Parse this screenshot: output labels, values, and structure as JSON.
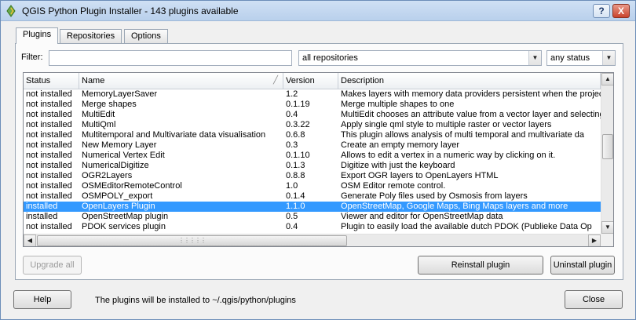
{
  "window": {
    "title": "QGIS Python Plugin Installer - 143 plugins available",
    "help_glyph": "?",
    "close_glyph": "X"
  },
  "tabs": [
    {
      "label": "Plugins",
      "active": true
    },
    {
      "label": "Repositories",
      "active": false
    },
    {
      "label": "Options",
      "active": false
    }
  ],
  "filter": {
    "label": "Filter:",
    "value": "",
    "placeholder": ""
  },
  "repository_select": {
    "selected": "all repositories"
  },
  "status_select": {
    "selected": "any status"
  },
  "table": {
    "columns": [
      "Status",
      "Name",
      "Version",
      "Description"
    ],
    "rows": [
      {
        "status": "not installed",
        "name": "MemoryLayerSaver",
        "version": "1.2",
        "description": "Makes layers with memory data providers persistent when the projec",
        "selected": false
      },
      {
        "status": "not installed",
        "name": "Merge shapes",
        "version": "0.1.19",
        "description": "Merge multiple shapes to one",
        "selected": false
      },
      {
        "status": "not installed",
        "name": "MultiEdit",
        "version": "0.4",
        "description": "MultiEdit chooses an attribute value from a vector layer and selecting",
        "selected": false
      },
      {
        "status": "not installed",
        "name": "MultiQml",
        "version": "0.3.22",
        "description": "Apply single qml style to multiple raster or vector layers",
        "selected": false
      },
      {
        "status": "not installed",
        "name": "Multitemporal and Multivariate data visualisation",
        "version": "0.6.8",
        "description": "This plugin allows analysis of multi temporal and multivariate da",
        "selected": false
      },
      {
        "status": "not installed",
        "name": "New Memory Layer",
        "version": "0.3",
        "description": "Create an empty memory layer",
        "selected": false
      },
      {
        "status": "not installed",
        "name": "Numerical Vertex Edit",
        "version": "0.1.10",
        "description": "Allows to edit a vertex in a numeric way by clicking on it.",
        "selected": false
      },
      {
        "status": "not installed",
        "name": "NumericalDigitize",
        "version": "0.1.3",
        "description": "Digitize with just the keyboard",
        "selected": false
      },
      {
        "status": "not installed",
        "name": "OGR2Layers",
        "version": "0.8.8",
        "description": "Export OGR layers to OpenLayers HTML",
        "selected": false
      },
      {
        "status": "not installed",
        "name": "OSMEditorRemoteControl",
        "version": "1.0",
        "description": "OSM Editor remote control.",
        "selected": false
      },
      {
        "status": "not installed",
        "name": "OSMPOLY_export",
        "version": "0.1.4",
        "description": "Generate Poly files used by Osmosis from layers",
        "selected": false
      },
      {
        "status": "installed",
        "name": "OpenLayers Plugin",
        "version": "1.1.0",
        "description": "OpenStreetMap, Google Maps, Bing Maps layers and more",
        "selected": true
      },
      {
        "status": "installed",
        "name": "OpenStreetMap plugin",
        "version": "0.5",
        "description": "Viewer and editor for OpenStreetMap data",
        "selected": false
      },
      {
        "status": "not installed",
        "name": "PDOK services plugin",
        "version": "0.4",
        "description": "Plugin to easily load the available dutch PDOK (Publieke Data Op",
        "selected": false
      }
    ]
  },
  "buttons": {
    "upgrade_all": "Upgrade all",
    "reinstall": "Reinstall plugin",
    "uninstall": "Uninstall plugin",
    "help": "Help",
    "close": "Close"
  },
  "footer_note": "The plugins will be installed to ~/.qgis/python/plugins",
  "colors": {
    "selection": "#3399ff",
    "window_bg": "#f0f0f0",
    "titlebar": "#b9d0ec"
  }
}
